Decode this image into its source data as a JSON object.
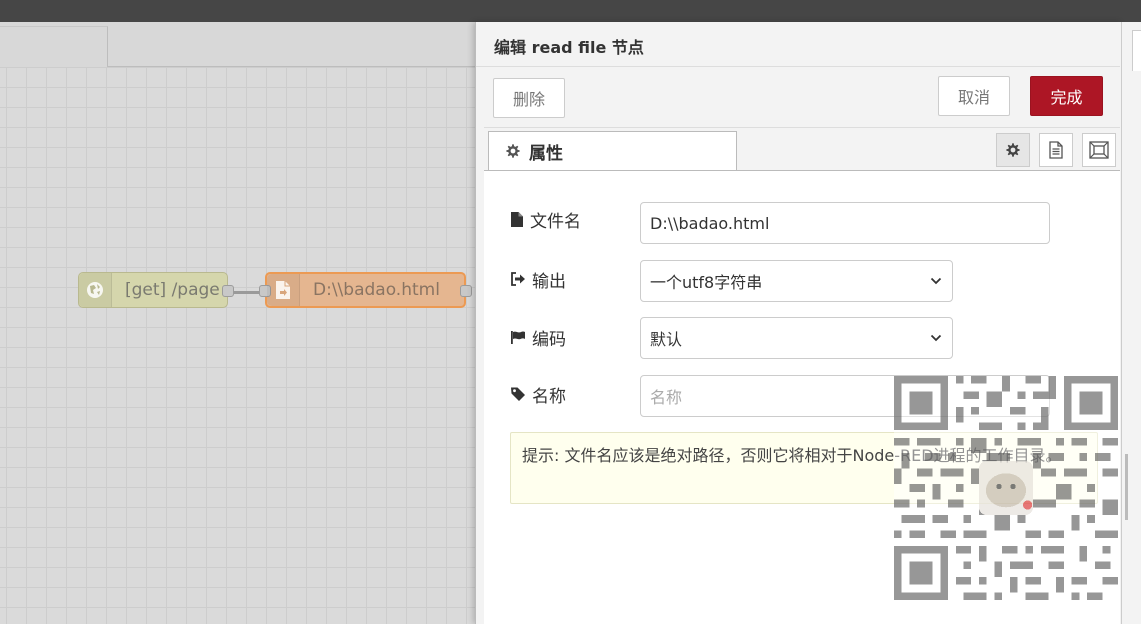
{
  "workspace": {
    "nodes": [
      {
        "label": "[get] /page",
        "type": "http-in",
        "icon": "globe-icon"
      },
      {
        "label": "D:\\\\badao.html",
        "type": "file-in",
        "icon": "file-in-icon",
        "selected": true
      }
    ]
  },
  "editor": {
    "title": "编辑 read file 节点",
    "buttons": {
      "delete": "删除",
      "cancel": "取消",
      "done": "完成"
    },
    "tabs": {
      "properties": "属性"
    },
    "icon_tabs": [
      "gear-icon",
      "description-icon",
      "appearance-icon"
    ],
    "form": {
      "filename": {
        "label": "文件名",
        "value": "D:\\\\badao.html",
        "icon": "file-icon"
      },
      "output": {
        "label": "输出",
        "selected": "一个utf8字符串",
        "icon": "sign-out-icon"
      },
      "encoding": {
        "label": "编码",
        "selected": "默认",
        "icon": "flag-icon"
      },
      "name": {
        "label": "名称",
        "placeholder": "名称",
        "value": "",
        "icon": "tag-icon"
      },
      "tip": "提示: 文件名应该是绝对路径，否则它将相对于Node-RED进程的工作目录。"
    }
  },
  "colors": {
    "topbar": "#464646",
    "done_button": "#ad1625",
    "http_node": "#d5d6ac",
    "file_node": "#e5b690",
    "selected_border": "#ec9a53"
  }
}
